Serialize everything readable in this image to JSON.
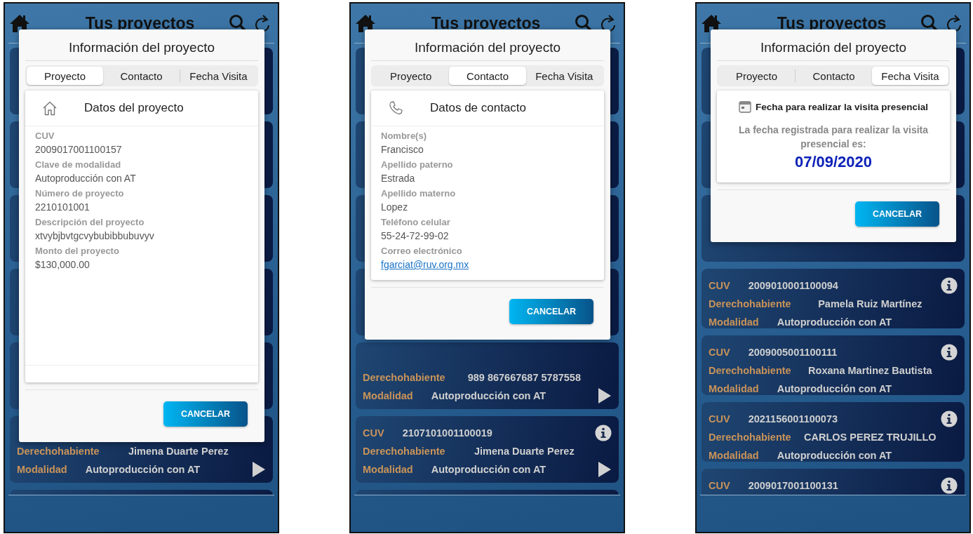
{
  "screens": [
    {
      "header": {
        "title": "Tus proyectos"
      },
      "cards": [
        {
          "covered": true
        },
        {
          "covered": true
        },
        {
          "covered": true
        },
        {
          "covered": true
        },
        {
          "covered": true
        },
        {
          "covered": false,
          "holder": {
            "label": "Derechohabiente",
            "value": "Jimena Duarte Perez"
          },
          "modality": {
            "label": "Modalidad",
            "value": "Autoproducción con AT"
          },
          "info_icon": false,
          "play_icon": true
        },
        {
          "covered": true
        }
      ],
      "dialog": {
        "title": "Información del proyecto",
        "tabs": [
          {
            "label": "Proyecto",
            "selected": true
          },
          {
            "label": "Contacto",
            "selected": false
          },
          {
            "label": "Fecha Visita",
            "selected": false
          }
        ],
        "section": {
          "kind": "project",
          "heading": "Datos del proyecto",
          "fields": [
            {
              "kind": "text",
              "label": "CUV",
              "value": "2009017001100157"
            },
            {
              "kind": "text",
              "label": "Clave de modalidad",
              "value": "Autoproducción con AT"
            },
            {
              "kind": "text",
              "label": "Número de proyecto",
              "value": "2210101001"
            },
            {
              "kind": "text",
              "label": "Descripción del proyecto",
              "value": "xtvybjbvtgcvybubibbubuvyv"
            },
            {
              "kind": "text",
              "label": "Monto del proyecto",
              "value": "$130,000.00"
            }
          ]
        },
        "cancel_button": "CANCELAR"
      }
    },
    {
      "header": {
        "title": "Tus proyectos"
      },
      "cards": [
        {
          "covered": true
        },
        {
          "covered": true
        },
        {
          "covered": true
        },
        {
          "covered": true
        },
        {
          "covered": false,
          "holder": {
            "label": "Derechohabiente",
            "value": "989 867667687 5787558"
          },
          "modality": {
            "label": "Modalidad",
            "value": "Autoproducción con AT"
          },
          "info_icon": false,
          "play_icon": true
        },
        {
          "covered": false,
          "cuv": {
            "label": "CUV",
            "value": "2107101001100019"
          },
          "holder": {
            "label": "Derechohabiente",
            "value": "Jimena Duarte Perez"
          },
          "modality": {
            "label": "Modalidad",
            "value": "Autoproducción con AT"
          },
          "info_icon": true,
          "play_icon": true
        },
        {
          "covered": true
        }
      ],
      "dialog": {
        "title": "Información del proyecto",
        "tabs": [
          {
            "label": "Proyecto",
            "selected": false
          },
          {
            "label": "Contacto",
            "selected": true
          },
          {
            "label": "Fecha Visita",
            "selected": false
          }
        ],
        "section": {
          "kind": "contact",
          "heading": "Datos de contacto",
          "fields": [
            {
              "kind": "text",
              "label": "Nombre(s)",
              "value": "Francisco"
            },
            {
              "kind": "text",
              "label": "Apellido paterno",
              "value": "Estrada"
            },
            {
              "kind": "text",
              "label": "Apellido materno",
              "value": "Lopez"
            },
            {
              "kind": "text",
              "label": "Teléfono celular",
              "value": "55-24-72-99-02"
            },
            {
              "kind": "link",
              "label": "Correo electrónico",
              "value": "fgarciat@ruv.org.mx"
            }
          ]
        },
        "cancel_button": "CANCELAR"
      }
    },
    {
      "header": {
        "title": "Tus proyectos"
      },
      "cards": [
        {
          "covered": true
        },
        {
          "covered": true
        },
        {
          "covered": true
        },
        {
          "covered": false,
          "cuv": {
            "label": "CUV",
            "value": "2009010001100094"
          },
          "holder": {
            "label": "Derechohabiente",
            "value": "Pamela Ruiz Martínez"
          },
          "modality": {
            "label": "Modalidad",
            "value": "Autoproducción con AT"
          },
          "info_icon": true,
          "play_icon": false
        },
        {
          "covered": false,
          "cuv": {
            "label": "CUV",
            "value": "2009005001100111"
          },
          "holder": {
            "label": "Derechohabiente",
            "value": "Roxana Martinez Bautista"
          },
          "modality": {
            "label": "Modalidad",
            "value": "Autoproducción con AT"
          },
          "info_icon": true,
          "play_icon": false
        },
        {
          "covered": false,
          "cuv": {
            "label": "CUV",
            "value": "2021156001100073"
          },
          "holder": {
            "label": "Derechohabiente",
            "value": "CARLOS PEREZ TRUJILLO"
          },
          "modality": {
            "label": "Modalidad",
            "value": "Autoproducción con AT"
          },
          "info_icon": true,
          "play_icon": false
        },
        {
          "covered": false,
          "cuv": {
            "label": "CUV",
            "value": "2009017001100131"
          },
          "info_icon": true,
          "play_icon": false
        }
      ],
      "dialog": {
        "title": "Información del proyecto",
        "tabs": [
          {
            "label": "Proyecto",
            "selected": false
          },
          {
            "label": "Contacto",
            "selected": false
          },
          {
            "label": "Fecha Visita",
            "selected": true
          }
        ],
        "section": {
          "kind": "visit",
          "heading": "Fecha para realizar la visita presencial",
          "message": "La fecha registrada para realizar la visita presencial es:",
          "date": "07/09/2020"
        },
        "cancel_button": "CANCELAR"
      }
    }
  ]
}
